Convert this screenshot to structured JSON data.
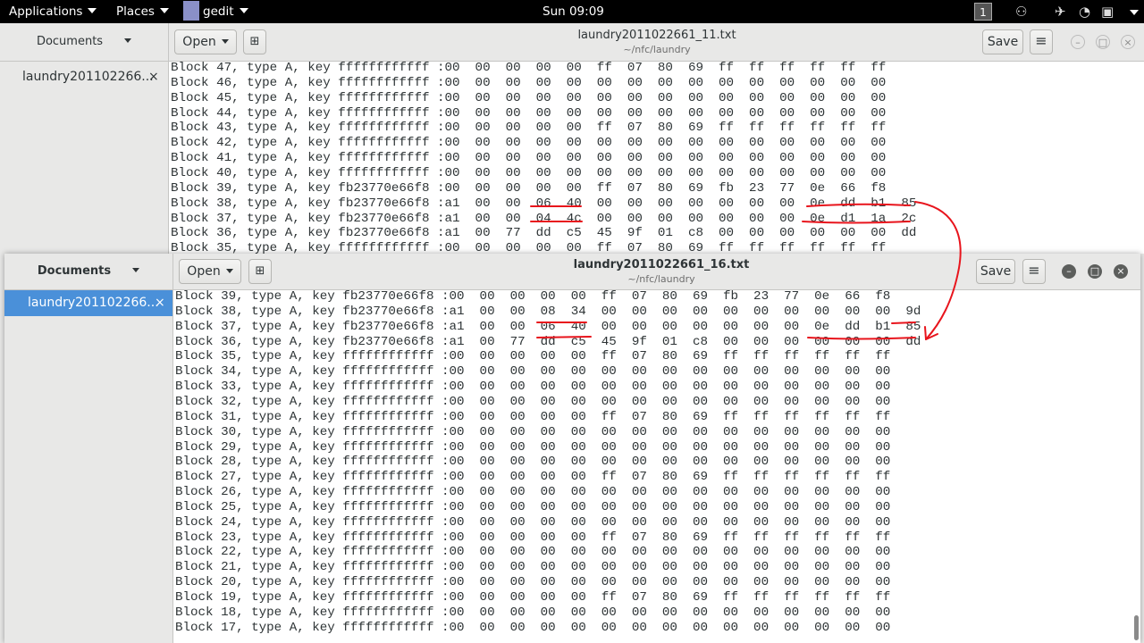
{
  "topbar": {
    "applications": "Applications",
    "places": "Places",
    "app": "gedit",
    "clock": "Sun 09:09",
    "workspace": "1"
  },
  "back_window": {
    "side_header": "Documents",
    "doc": "laundry201102266...",
    "open_label": "Open",
    "title": "laundry2011022661_11.txt",
    "subtitle": "~/nfc/laundry",
    "save_label": "Save",
    "lines": [
      "Block 47, type A, key ffffffffffff :00  00  00  00  00  ff  07  80  69  ff  ff  ff  ff  ff  ff",
      "Block 46, type A, key ffffffffffff :00  00  00  00  00  00  00  00  00  00  00  00  00  00  00",
      "Block 45, type A, key ffffffffffff :00  00  00  00  00  00  00  00  00  00  00  00  00  00  00",
      "Block 44, type A, key ffffffffffff :00  00  00  00  00  00  00  00  00  00  00  00  00  00  00",
      "Block 43, type A, key ffffffffffff :00  00  00  00  00  ff  07  80  69  ff  ff  ff  ff  ff  ff",
      "Block 42, type A, key ffffffffffff :00  00  00  00  00  00  00  00  00  00  00  00  00  00  00",
      "Block 41, type A, key ffffffffffff :00  00  00  00  00  00  00  00  00  00  00  00  00  00  00",
      "Block 40, type A, key ffffffffffff :00  00  00  00  00  00  00  00  00  00  00  00  00  00  00",
      "Block 39, type A, key fb23770e66f8 :00  00  00  00  00  ff  07  80  69  fb  23  77  0e  66  f8",
      "Block 38, type A, key fb23770e66f8 :a1  00  00  06  40  00  00  00  00  00  00  00  0e  dd  b1  85",
      "Block 37, type A, key fb23770e66f8 :a1  00  00  04  4c  00  00  00  00  00  00  00  0e  d1  1a  2c",
      "Block 36, type A, key fb23770e66f8 :a1  00  77  dd  c5  45  9f  01  c8  00  00  00  00  00  00  dd",
      "Block 35, type A, key ffffffffffff :00  00  00  00  00  ff  07  80  69  ff  ff  ff  ff  ff  ff"
    ]
  },
  "front_window": {
    "side_header": "Documents",
    "doc": "laundry201102266...",
    "open_label": "Open",
    "title": "laundry2011022661_16.txt",
    "subtitle": "~/nfc/laundry",
    "save_label": "Save",
    "lines": [
      "Block 39, type A, key fb23770e66f8 :00  00  00  00  00  ff  07  80  69  fb  23  77  0e  66  f8",
      "Block 38, type A, key fb23770e66f8 :a1  00  00  08  34  00  00  00  00  00  00  00  00  00  00  9d",
      "Block 37, type A, key fb23770e66f8 :a1  00  00  06  40  00  00  00  00  00  00  00  0e  dd  b1  85",
      "Block 36, type A, key fb23770e66f8 :a1  00  77  dd  c5  45  9f  01  c8  00  00  00  00  00  00  dd",
      "Block 35, type A, key ffffffffffff :00  00  00  00  00  ff  07  80  69  ff  ff  ff  ff  ff  ff",
      "Block 34, type A, key ffffffffffff :00  00  00  00  00  00  00  00  00  00  00  00  00  00  00",
      "Block 33, type A, key ffffffffffff :00  00  00  00  00  00  00  00  00  00  00  00  00  00  00",
      "Block 32, type A, key ffffffffffff :00  00  00  00  00  00  00  00  00  00  00  00  00  00  00",
      "Block 31, type A, key ffffffffffff :00  00  00  00  00  ff  07  80  69  ff  ff  ff  ff  ff  ff",
      "Block 30, type A, key ffffffffffff :00  00  00  00  00  00  00  00  00  00  00  00  00  00  00",
      "Block 29, type A, key ffffffffffff :00  00  00  00  00  00  00  00  00  00  00  00  00  00  00",
      "Block 28, type A, key ffffffffffff :00  00  00  00  00  00  00  00  00  00  00  00  00  00  00",
      "Block 27, type A, key ffffffffffff :00  00  00  00  00  ff  07  80  69  ff  ff  ff  ff  ff  ff",
      "Block 26, type A, key ffffffffffff :00  00  00  00  00  00  00  00  00  00  00  00  00  00  00",
      "Block 25, type A, key ffffffffffff :00  00  00  00  00  00  00  00  00  00  00  00  00  00  00",
      "Block 24, type A, key ffffffffffff :00  00  00  00  00  00  00  00  00  00  00  00  00  00  00",
      "Block 23, type A, key ffffffffffff :00  00  00  00  00  ff  07  80  69  ff  ff  ff  ff  ff  ff",
      "Block 22, type A, key ffffffffffff :00  00  00  00  00  00  00  00  00  00  00  00  00  00  00",
      "Block 21, type A, key ffffffffffff :00  00  00  00  00  00  00  00  00  00  00  00  00  00  00",
      "Block 20, type A, key ffffffffffff :00  00  00  00  00  00  00  00  00  00  00  00  00  00  00",
      "Block 19, type A, key ffffffffffff :00  00  00  00  00  ff  07  80  69  ff  ff  ff  ff  ff  ff",
      "Block 18, type A, key ffffffffffff :00  00  00  00  00  00  00  00  00  00  00  00  00  00  00",
      "Block 17, type A, key ffffffffffff :00  00  00  00  00  00  00  00  00  00  00  00  00  00  00"
    ]
  },
  "colors": {
    "annotation": "#e8141c",
    "selection": "#4a90d9"
  }
}
